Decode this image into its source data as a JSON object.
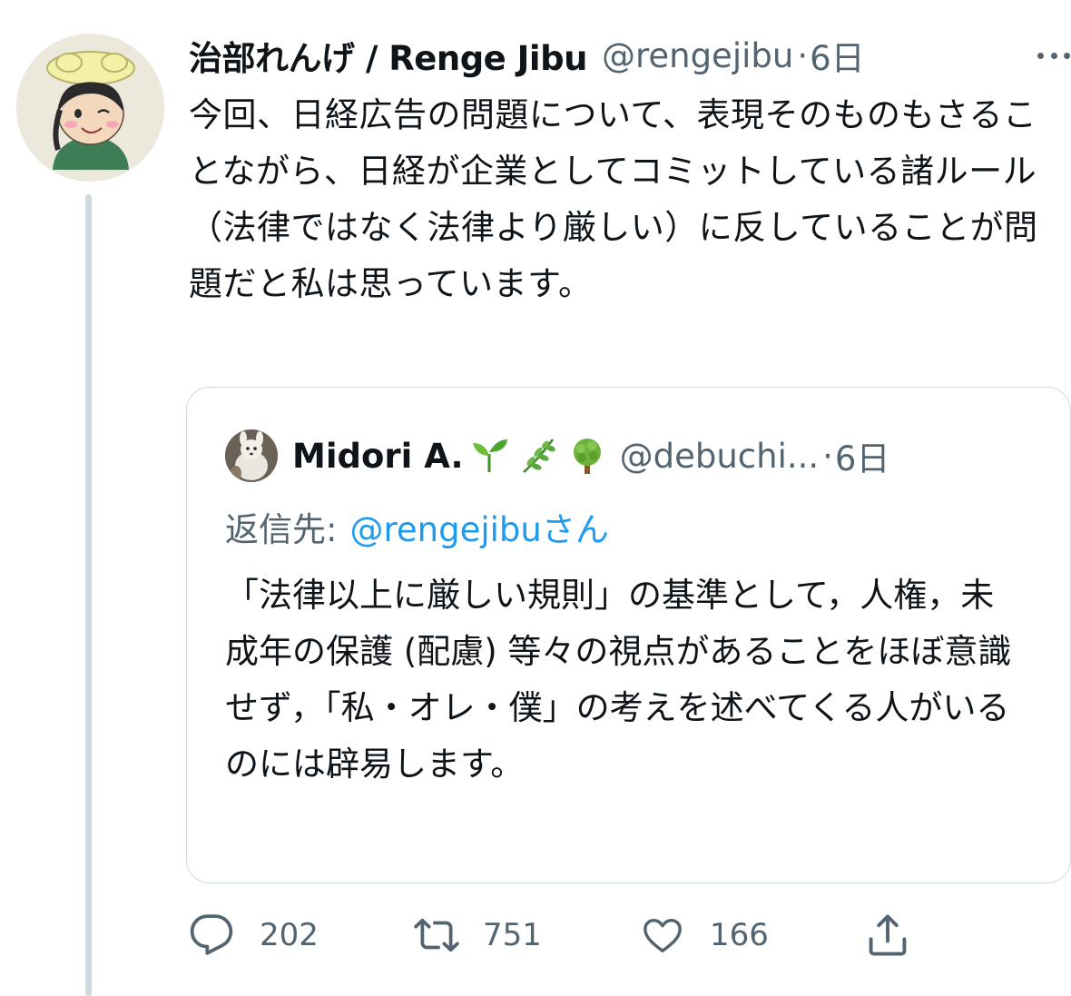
{
  "tweet": {
    "display_name": "治部れんげ / Renge Jibu",
    "handle": "@rengejibu",
    "separator": "·",
    "time": "6日",
    "text": "今回、日経広告の問題について、表現そのものもさることながら、日経が企業としてコミットしている諸ルール（法律ではなく法律より厳しい）に反していることが問題だと私は思っています。",
    "avatar_icon": "profile-drawing-avatar",
    "more_icon": "more-horizontal-icon"
  },
  "quoted": {
    "display_name": "Midori A.",
    "emoji_icons": [
      "seedling-emoji",
      "herb-emoji",
      "deciduous-tree-emoji"
    ],
    "handle": "@debuchi...",
    "separator": "·",
    "time": "6日",
    "reply_prefix": "返信先:",
    "reply_mention": "@rengejibu",
    "reply_suffix": "さん",
    "text": "「法律以上に厳しい規則」の基準として，人権，未成年の保護 (配慮) 等々の視点があることをほぼ意識せず，「私・オレ・僕」の考えを述べてくる人がいるのには辟易します。"
  },
  "actions": {
    "reply_count": "202",
    "retweet_count": "751",
    "like_count": "166"
  },
  "colors": {
    "text": "#0f1419",
    "secondary": "#536471",
    "link": "#1d9bf0",
    "border": "#cfd9de"
  }
}
